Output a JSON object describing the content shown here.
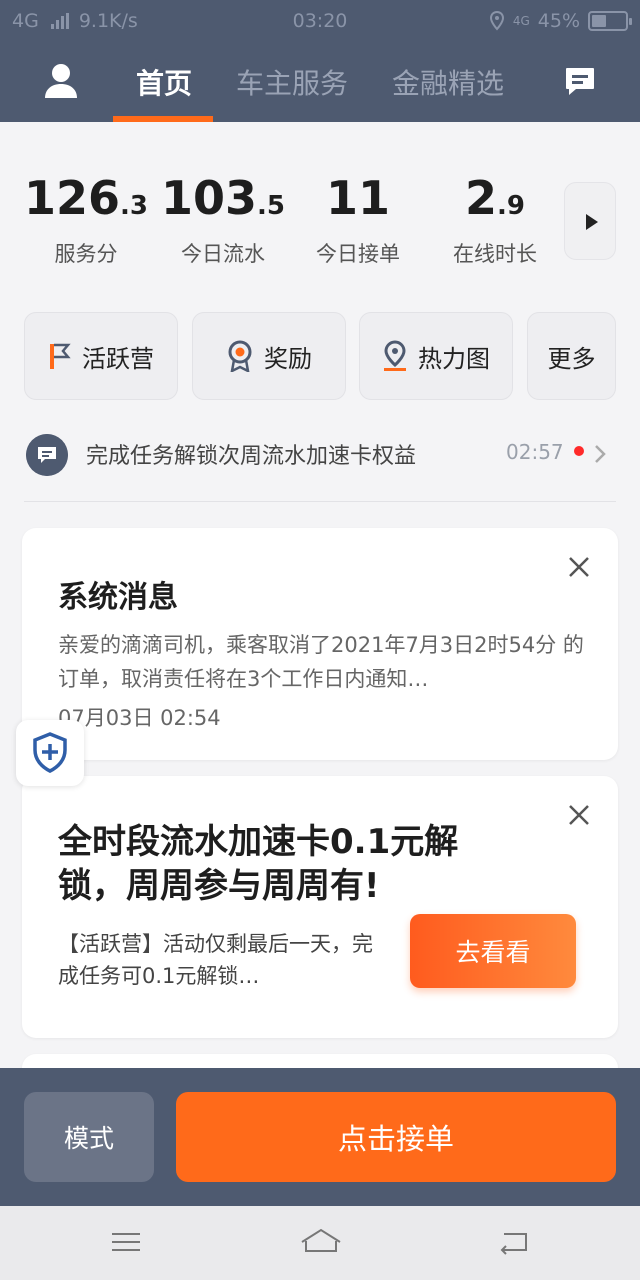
{
  "status_bar": {
    "network": "4G",
    "speed": "9.1K/s",
    "time": "03:20",
    "network_right": "4G",
    "battery": "45%"
  },
  "header": {
    "tabs": [
      {
        "label": "首页",
        "active": true
      },
      {
        "label": "车主服务",
        "active": false
      },
      {
        "label": "金融精选",
        "active": false
      }
    ],
    "icons": [
      "person-icon",
      "message-icon"
    ]
  },
  "stats": [
    {
      "int": "126",
      "dec": ".3",
      "label": "服务分"
    },
    {
      "int": "103",
      "dec": ".5",
      "label": "今日流水"
    },
    {
      "int": "11",
      "dec": "",
      "label": "今日接单"
    },
    {
      "int": "2",
      "dec": ".9",
      "label": "在线时长"
    }
  ],
  "quick_links": [
    {
      "label": "活跃营",
      "icon": "flag-icon"
    },
    {
      "label": "奖励",
      "icon": "medal-icon"
    },
    {
      "label": "热力图",
      "icon": "location-pin-icon"
    },
    {
      "label": "更多",
      "icon": ""
    }
  ],
  "notice": {
    "text": "完成任务解锁次周流水加速卡权益",
    "time": "02:57"
  },
  "cards": {
    "system_message": {
      "title": "系统消息",
      "body": "亲爱的滴滴司机，乘客取消了2021年7月3日2时54分 的订单，取消责任将在3个工作日内通知…",
      "date": "07月03日 02:54"
    },
    "promo": {
      "title": "全时段流水加速卡0.1元解锁，周周参与周周有!",
      "desc": "【活跃营】活动仅剩最后一天，完成任务可0.1元解锁…",
      "button": "去看看"
    }
  },
  "bottom_bar": {
    "mode_label": "模式",
    "accept_label": "点击接单"
  },
  "colors": {
    "header_bg": "#4e5a70",
    "accent": "#ff6a1a"
  }
}
